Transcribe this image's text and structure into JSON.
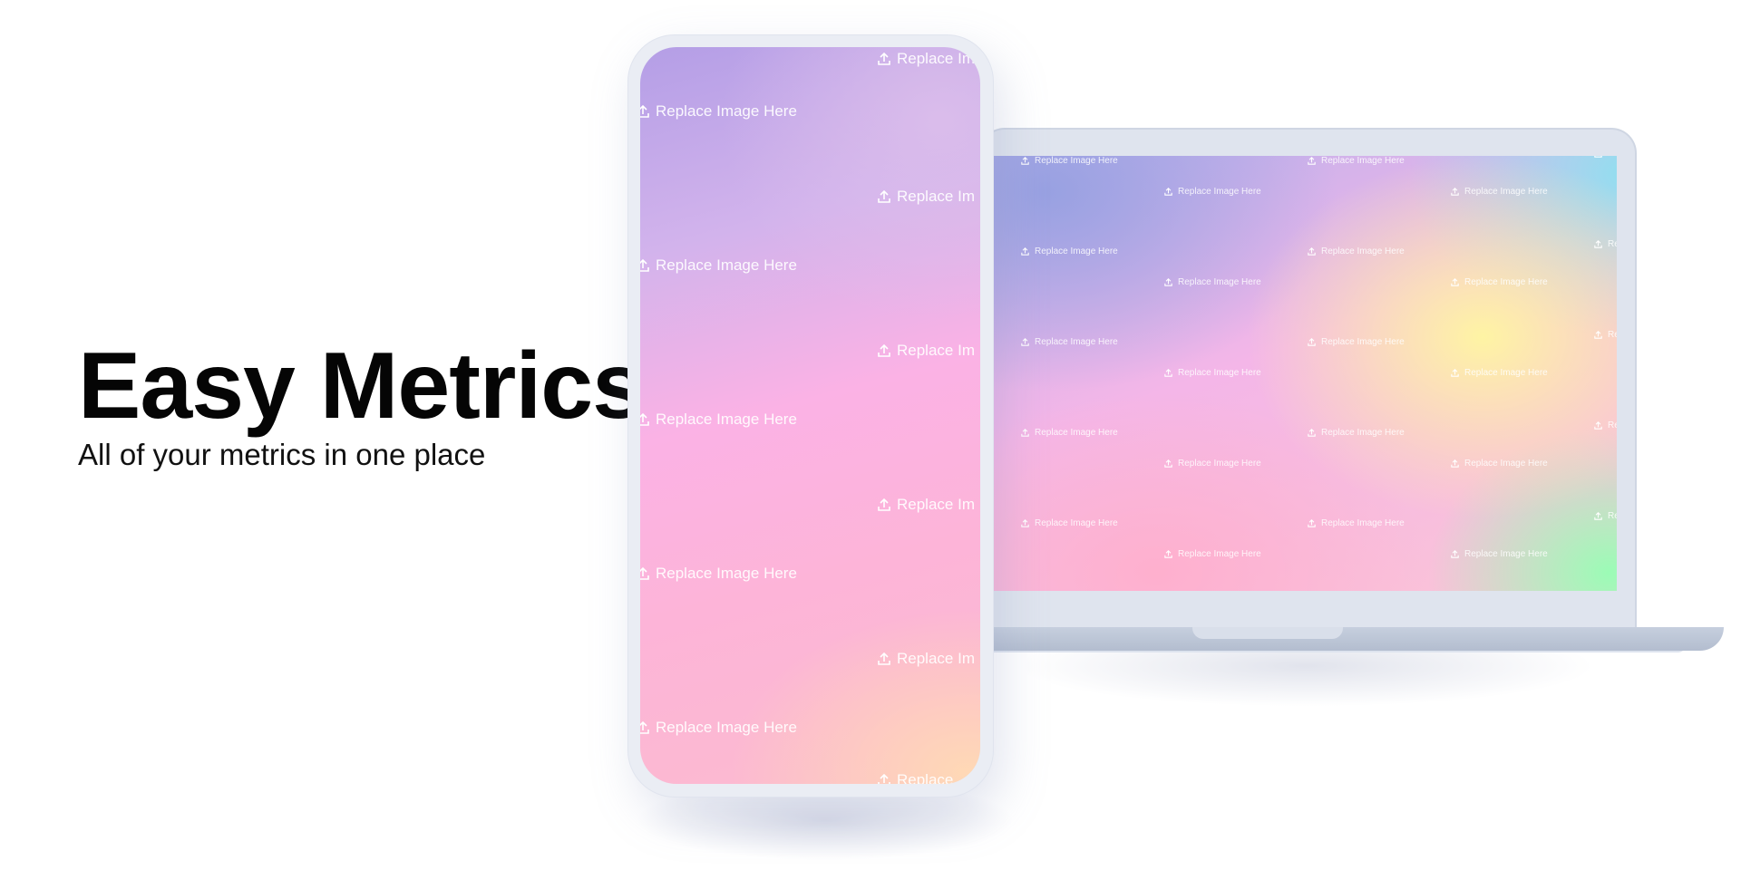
{
  "hero": {
    "title": "Easy Metrics",
    "subtitle": "All of your metrics in one place"
  },
  "placeholder": {
    "label": "Replace Image Here",
    "short_label": "Replace Im",
    "cut_label": "Replace",
    "icon": "upload-icon"
  },
  "colors": {
    "title": "#050505",
    "device_frame": "#e2e6ef",
    "gradient_purple": "#b49ee6",
    "gradient_pink": "#fbb2e5",
    "gradient_yellow": "#fff7a0",
    "gradient_green": "#96ffb4",
    "gradient_cyan": "#8ce1f0"
  }
}
